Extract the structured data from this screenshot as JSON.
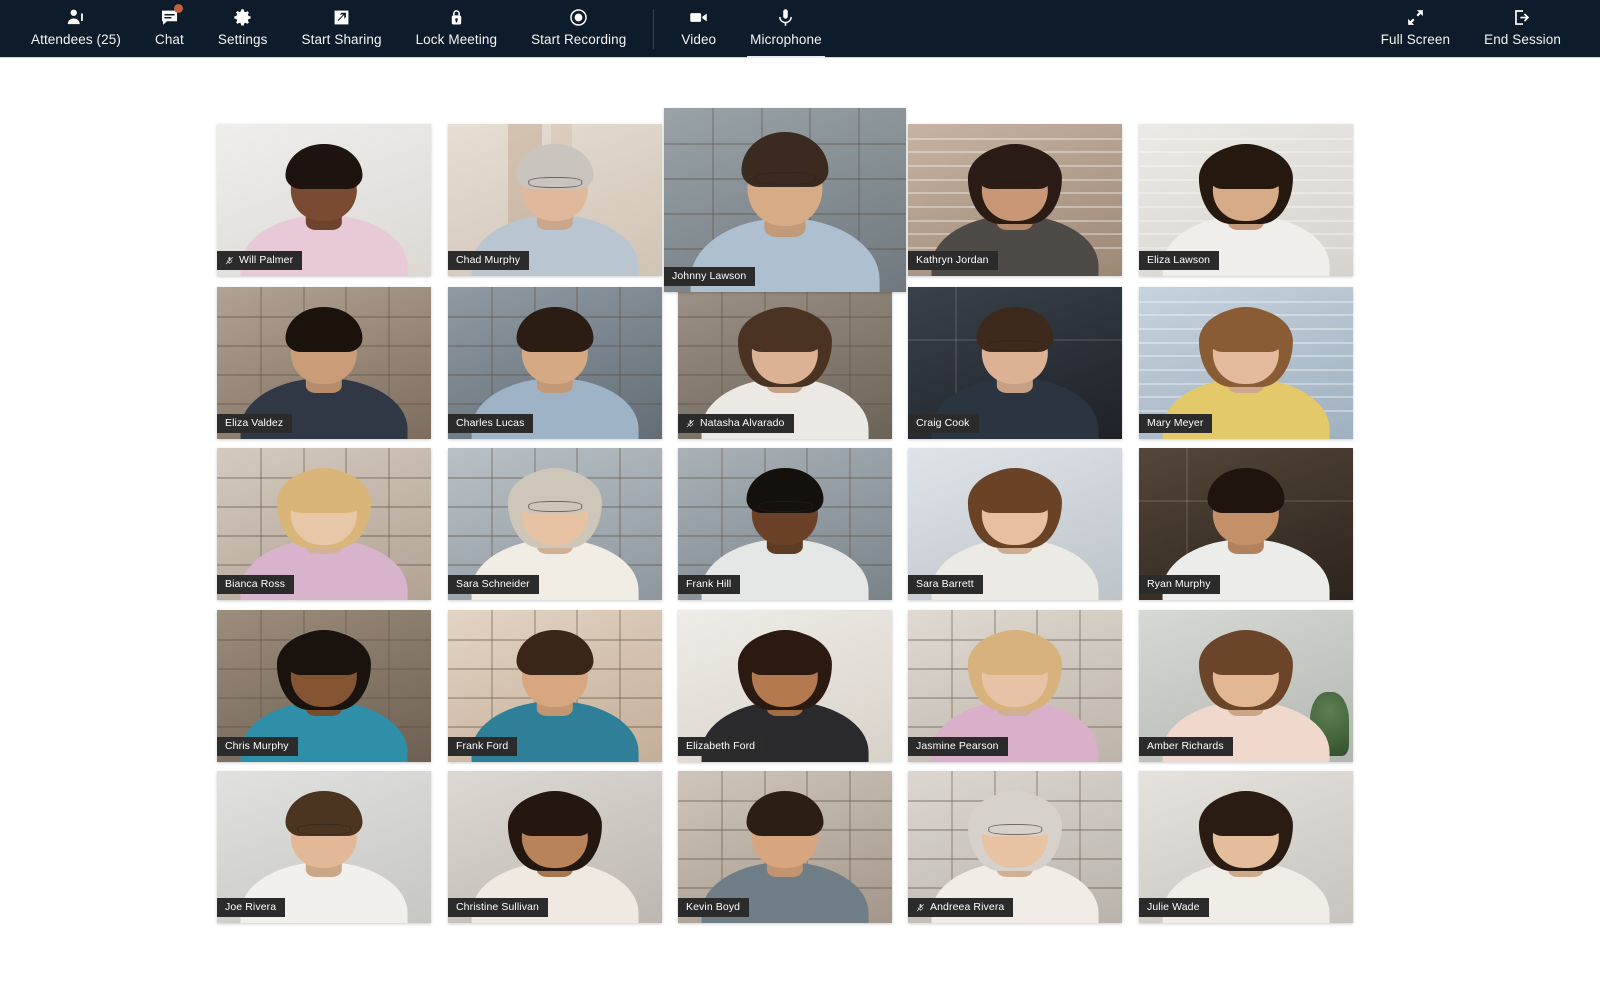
{
  "app": {
    "title": "Video Conference Meeting Grid",
    "toolbar_bg": "#0d1b2a",
    "accent": "#c1603f",
    "nameplate_bg": "#2b2b2b",
    "stage_bg": "#ffffff"
  },
  "toolbar": {
    "left_items": [
      {
        "label": "Attendees (25)",
        "icon": "attendees-icon",
        "badge": false
      },
      {
        "label": "Chat",
        "icon": "chat-icon",
        "badge": true
      },
      {
        "label": "Settings",
        "icon": "gear-icon",
        "badge": false
      },
      {
        "label": "Start Sharing",
        "icon": "screen-share-icon",
        "badge": false
      },
      {
        "label": "Lock Meeting",
        "icon": "lock-icon",
        "badge": false
      },
      {
        "label": "Start Recording",
        "icon": "record-icon",
        "badge": false
      }
    ],
    "divider": "separator",
    "media_items": [
      {
        "label": "Video",
        "icon": "camera-icon",
        "badge": false
      },
      {
        "label": "Microphone",
        "icon": "microphone-icon",
        "badge": false,
        "active_underline": true
      }
    ],
    "right_items": [
      {
        "label": "Full Screen",
        "icon": "expand-icon"
      },
      {
        "label": "End Session",
        "icon": "exit-icon"
      }
    ]
  },
  "grid": {
    "columns": 5,
    "rows": 5,
    "participant_count": 25,
    "active_speaker": "Johnny Lawson",
    "tiles": [
      {
        "name": "Will Palmer",
        "muted": true,
        "active": false,
        "skin": "#7a4a32",
        "hair": "#1d140f",
        "shirt": "#e8c9d8",
        "bg1": "#efeeec",
        "bg2": "#dcd9d4",
        "room": "plain",
        "hairstyle": "short",
        "glasses": false
      },
      {
        "name": "Chad Murphy",
        "muted": false,
        "active": false,
        "skin": "#e0b89c",
        "hair": "#c9c4bd",
        "shirt": "#b9c6d2",
        "bg1": "#e7ded3",
        "bg2": "#cfc3b4",
        "room": "curtain",
        "hairstyle": "short",
        "glasses": true
      },
      {
        "name": "Johnny Lawson",
        "muted": false,
        "active": true,
        "skin": "#d8ab87",
        "hair": "#3a2a20",
        "shirt": "#aebfd0",
        "bg1": "#9aa3a8",
        "bg2": "#6f787e",
        "room": "shelves",
        "hairstyle": "short",
        "glasses": true
      },
      {
        "name": "Kathryn Jordan",
        "muted": false,
        "active": false,
        "skin": "#c99775",
        "hair": "#2a1c14",
        "shirt": "#4e4a46",
        "bg1": "#c6b3a2",
        "bg2": "#9d8876",
        "room": "blinds",
        "hairstyle": "long",
        "glasses": true
      },
      {
        "name": "Eliza Lawson",
        "muted": false,
        "active": false,
        "skin": "#d7aa88",
        "hair": "#24180f",
        "shirt": "#f0eeea",
        "bg1": "#eceae6",
        "bg2": "#d6d3cd",
        "room": "blinds",
        "hairstyle": "long",
        "glasses": false
      },
      {
        "name": "Eliza Valdez",
        "muted": false,
        "active": false,
        "skin": "#cb9c78",
        "hair": "#1b120c",
        "shirt": "#2f3844",
        "bg1": "#b2a293",
        "bg2": "#7d6d5e",
        "room": "shelves",
        "hairstyle": "short",
        "glasses": false
      },
      {
        "name": "Charles Lucas",
        "muted": false,
        "active": false,
        "skin": "#d6a985",
        "hair": "#2b1d14",
        "shirt": "#9fb3c6",
        "bg1": "#8f9aa3",
        "bg2": "#636d76",
        "room": "shelves",
        "hairstyle": "short",
        "glasses": false
      },
      {
        "name": "Natasha Alvarado",
        "muted": true,
        "active": false,
        "skin": "#dcb294",
        "hair": "#4a3322",
        "shirt": "#ece9e4",
        "bg1": "#9c9288",
        "bg2": "#6b6258",
        "room": "shelves",
        "hairstyle": "long",
        "glasses": false
      },
      {
        "name": "Craig Cook",
        "muted": false,
        "active": false,
        "skin": "#ddb294",
        "hair": "#3d2a1c",
        "shirt": "#2b3540",
        "bg1": "#39414a",
        "bg2": "#1e2228",
        "room": "dark",
        "hairstyle": "short",
        "glasses": true
      },
      {
        "name": "Mary Meyer",
        "muted": false,
        "active": false,
        "skin": "#e3bb9c",
        "hair": "#8a5c35",
        "shirt": "#e3c96a",
        "bg1": "#c7d3dd",
        "bg2": "#9fb0bf",
        "room": "blinds",
        "hairstyle": "long",
        "glasses": false
      },
      {
        "name": "Bianca Ross",
        "muted": false,
        "active": false,
        "skin": "#e8c6a8",
        "hair": "#d9b579",
        "shirt": "#d8b4cc",
        "bg1": "#d4cabf",
        "bg2": "#b1a294",
        "room": "shelves",
        "hairstyle": "long",
        "glasses": false
      },
      {
        "name": "Sara Schneider",
        "muted": false,
        "active": false,
        "skin": "#e7c3a4",
        "hair": "#cfc6ba",
        "shirt": "#f1ece4",
        "bg1": "#b9c1c6",
        "bg2": "#8d979e",
        "room": "shelves",
        "hairstyle": "long",
        "glasses": true
      },
      {
        "name": "Frank Hill",
        "muted": false,
        "active": false,
        "skin": "#6b4228",
        "hair": "#14100c",
        "shirt": "#e5e7e6",
        "bg1": "#aab2b8",
        "bg2": "#79838a",
        "room": "shelves",
        "hairstyle": "short",
        "glasses": true
      },
      {
        "name": "Sara Barrett",
        "muted": false,
        "active": false,
        "skin": "#e6c0a0",
        "hair": "#6a4226",
        "shirt": "#eceae5",
        "bg1": "#dfe4e8",
        "bg2": "#bcc4ca",
        "room": "plain",
        "hairstyle": "long",
        "glasses": false
      },
      {
        "name": "Ryan Murphy",
        "muted": false,
        "active": false,
        "skin": "#c49068",
        "hair": "#20150e",
        "shirt": "#ececea",
        "bg1": "#54463a",
        "bg2": "#2c241c",
        "room": "dark",
        "hairstyle": "short",
        "glasses": false
      },
      {
        "name": "Chris Murphy",
        "muted": false,
        "active": false,
        "skin": "#855433",
        "hair": "#1a120d",
        "shirt": "#2f8fa8",
        "bg1": "#9c8d7c",
        "bg2": "#6d6053",
        "room": "shelves",
        "hairstyle": "long",
        "glasses": false
      },
      {
        "name": "Frank Ford",
        "muted": false,
        "active": false,
        "skin": "#d8a77f",
        "hair": "#3a2519",
        "shirt": "#2e7f97",
        "bg1": "#e3d4c4",
        "bg2": "#c3ae98",
        "room": "shelves",
        "hairstyle": "short",
        "glasses": false
      },
      {
        "name": "Elizabeth Ford",
        "muted": false,
        "active": false,
        "skin": "#b3794f",
        "hair": "#2a1a11",
        "shirt": "#2a2a2c",
        "bg1": "#efece7",
        "bg2": "#d8d2c9",
        "room": "plain",
        "hairstyle": "long",
        "glasses": false
      },
      {
        "name": "Jasmine Pearson",
        "muted": false,
        "active": false,
        "skin": "#e6c3a6",
        "hair": "#d7b27c",
        "shirt": "#d9afc9",
        "bg1": "#e0dad2",
        "bg2": "#bdb4a9",
        "room": "shelves",
        "hairstyle": "long",
        "glasses": false
      },
      {
        "name": "Amber Richards",
        "muted": false,
        "active": false,
        "skin": "#e2b794",
        "hair": "#6b452a",
        "shirt": "#f0d8cc",
        "bg1": "#d7d9d4",
        "bg2": "#b2b6b1",
        "room": "plant",
        "hairstyle": "long",
        "glasses": false
      },
      {
        "name": "Joe Rivera",
        "muted": false,
        "active": false,
        "skin": "#e2b896",
        "hair": "#4b3420",
        "shirt": "#f2f0ec",
        "bg1": "#e1e1df",
        "bg2": "#c6c6c3",
        "room": "plain",
        "hairstyle": "short",
        "glasses": true
      },
      {
        "name": "Christine Sullivan",
        "muted": false,
        "active": false,
        "skin": "#b8835a",
        "hair": "#241710",
        "shirt": "#efe9e2",
        "bg1": "#ddd9d3",
        "bg2": "#bcb7b0",
        "room": "plain",
        "hairstyle": "long",
        "glasses": false
      },
      {
        "name": "Kevin Boyd",
        "muted": false,
        "active": false,
        "skin": "#d7a57e",
        "hair": "#2d1e14",
        "shirt": "#6e7d86",
        "bg1": "#cfc6ba",
        "bg2": "#a3978a",
        "room": "shelves",
        "hairstyle": "short",
        "glasses": false
      },
      {
        "name": "Andreea Rivera",
        "muted": true,
        "active": false,
        "skin": "#e7c2a3",
        "hair": "#d6d2cb",
        "shirt": "#f1ede6",
        "bg1": "#dcd8d1",
        "bg2": "#b8b3ab",
        "room": "shelves",
        "hairstyle": "long",
        "glasses": true
      },
      {
        "name": "Julie Wade",
        "muted": false,
        "active": false,
        "skin": "#e4bd9c",
        "hair": "#2a1c12",
        "shirt": "#f0ece6",
        "bg1": "#e6e3de",
        "bg2": "#c7c3bd",
        "room": "plain",
        "hairstyle": "long",
        "glasses": false
      }
    ]
  }
}
